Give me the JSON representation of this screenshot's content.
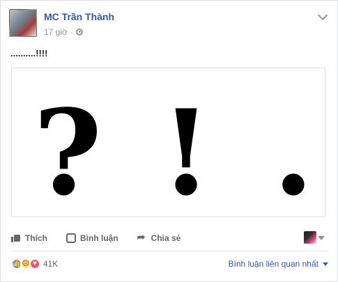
{
  "post": {
    "author": "MC Trần Thành",
    "time": "17 giờ",
    "separator": "·",
    "text": "..........!!!!"
  },
  "image": {
    "symbols": [
      "?",
      "!",
      "."
    ]
  },
  "actions": {
    "like": "Thích",
    "comment": "Bình luận",
    "share": "Chia sẻ"
  },
  "reactions": {
    "count": "41K",
    "types": [
      "like",
      "sad",
      "love"
    ]
  },
  "comments": {
    "sort_label": "Bình luận liên quan nhất"
  },
  "icons": {
    "globe": "globe-icon",
    "chevron": "chevron-down-icon",
    "like": "thumbs-up-icon",
    "comment": "comment-icon",
    "share": "share-icon"
  },
  "colors": {
    "link": "#365899",
    "text_muted": "#90949c",
    "action": "#606770",
    "like": "#5890ff",
    "love": "#f25268",
    "sad": "#ffd972"
  }
}
